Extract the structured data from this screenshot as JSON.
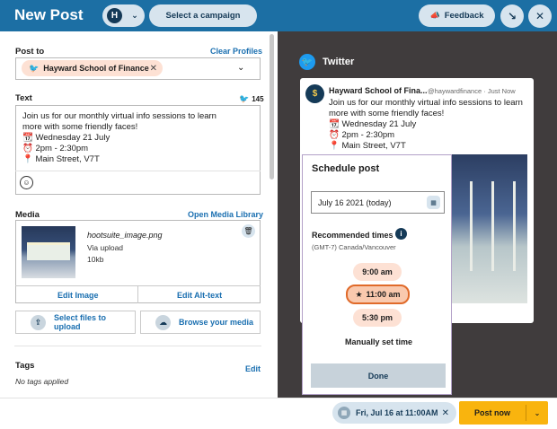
{
  "header": {
    "title": "New Post",
    "logo_letter": "H",
    "campaign_label": "Select a campaign",
    "feedback_label": "Feedback"
  },
  "post_to": {
    "label": "Post to",
    "clear_label": "Clear Profiles",
    "profile_name": "Hayward School of Finance"
  },
  "text": {
    "label": "Text",
    "char_count": "145",
    "lines": [
      "Join us for our monthly virtual info sessions to learn",
      "more with some friendly faces!",
      "📆 Wednesday 21 July",
      "⏰ 2pm - 2:30pm",
      "📍 Main Street, V7T"
    ]
  },
  "media": {
    "label": "Media",
    "open_library_label": "Open Media Library",
    "file_name": "hootsuite_image.png",
    "source": "Via upload",
    "size": "10kb",
    "edit_image_label": "Edit Image",
    "edit_alt_label": "Edit Alt-text",
    "select_files_label": "Select files to upload",
    "browse_label": "Browse your media"
  },
  "tags": {
    "label": "Tags",
    "edit_label": "Edit",
    "empty_text": "No tags applied"
  },
  "preview": {
    "network": "Twitter",
    "account_name": "Hayward School of Fina...",
    "handle": "@haywardfinance",
    "time": "Just Now",
    "lines": [
      "Join us for our monthly virtual info sessions to learn",
      "more with some friendly faces!",
      "📆 Wednesday 21 July",
      "⏰ 2pm - 2:30pm",
      "📍 Main Street, V7T"
    ]
  },
  "schedule": {
    "title": "Schedule post",
    "date_value": "July 16  2021  (today)",
    "recommended_label": "Recommended times",
    "timezone": "(GMT-7) Canada/Vancouver",
    "times": [
      "9:00 am",
      "11:00 am",
      "5:30 pm"
    ],
    "selected_time": "11:00 am",
    "manual_label": "Manually set time",
    "done_label": "Done"
  },
  "footer": {
    "scheduled_label": "Fri, Jul 16 at 11:00AM",
    "post_now_label": "Post now"
  },
  "colors": {
    "topbar": "#1c6fa4",
    "accent_link": "#1a6fb0",
    "preview_bg": "#403c3d",
    "chip_bg": "#fde1d4",
    "selected_time_border": "#e06a2a",
    "post_now_bg": "#f9b40e"
  }
}
